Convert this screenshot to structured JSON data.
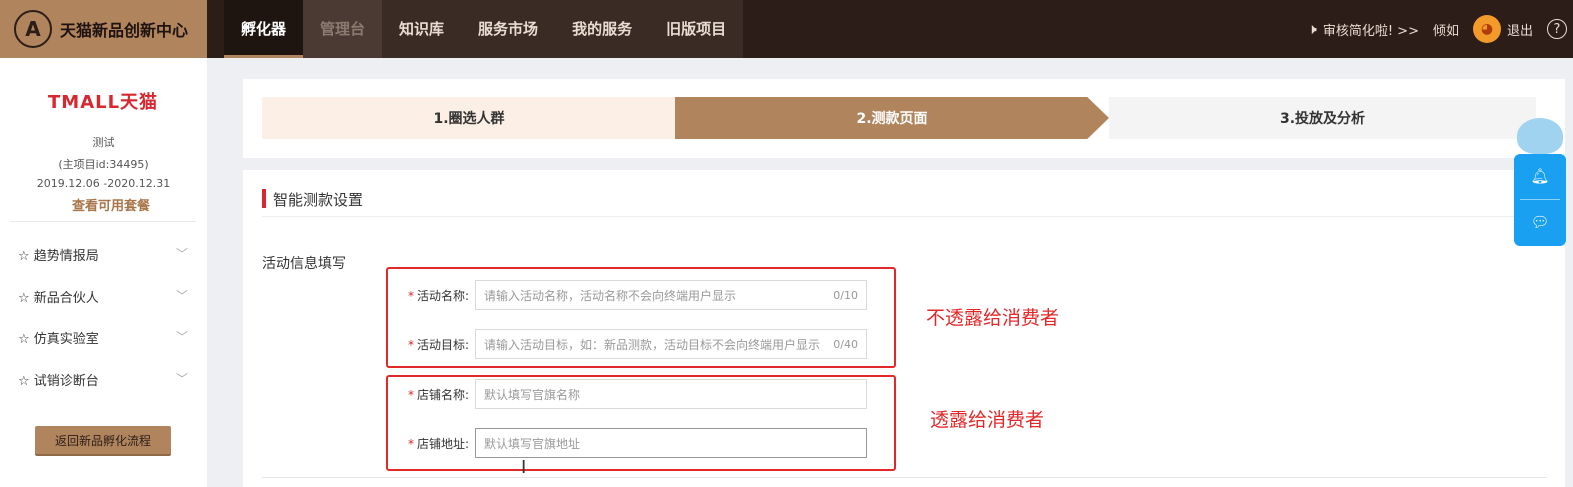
{
  "brand": {
    "logo_glyph": "A",
    "title": "天猫新品创新中心"
  },
  "nav": {
    "items": [
      "孵化器",
      "管理台",
      "知识库",
      "服务市场",
      "我的服务",
      "旧版项目"
    ]
  },
  "top_right": {
    "notice": "审核简化啦! >>",
    "user": "倾如",
    "avatar_glyph": "◕",
    "logout": "退出",
    "help": "?"
  },
  "sidebar": {
    "logo": "TMALL天猫",
    "project_name": "测试",
    "project_id": "(主项目id:34495)",
    "date_range": "2019.12.06 -2020.12.31",
    "view_package": "查看可用套餐",
    "menu": [
      {
        "label": "☆ 趋势情报局"
      },
      {
        "label": "☆ 新品合伙人"
      },
      {
        "label": "☆ 仿真实验室"
      },
      {
        "label": "☆ 试销诊断台"
      }
    ],
    "back_button": "返回新品孵化流程"
  },
  "steps": [
    "1.圈选人群",
    "2.测款页面",
    "3.投放及分析"
  ],
  "form": {
    "section_title": "智能测款设置",
    "subsection_title": "活动信息填写",
    "fields": [
      {
        "label": "活动名称:",
        "placeholder": "请输入活动名称，活动名称不会向终端用户显示",
        "count": "0/10"
      },
      {
        "label": "活动目标:",
        "placeholder": "请输入活动目标，如：新品测款，活动目标不会向终端用户显示",
        "count": "0/40"
      },
      {
        "label": "店铺名称:",
        "placeholder": "默认填写官旗名称",
        "count": ""
      },
      {
        "label": "店铺地址:",
        "placeholder": "默认填写官旗地址",
        "count": ""
      }
    ]
  },
  "annotations": {
    "hidden": "不透露给消费者",
    "shown": "透露给消费者"
  },
  "colors": {
    "brand": "#b0855e",
    "topbar": "#2c1d18",
    "accent_red": "#e3282a",
    "float_blue": "#1aa0f0"
  }
}
